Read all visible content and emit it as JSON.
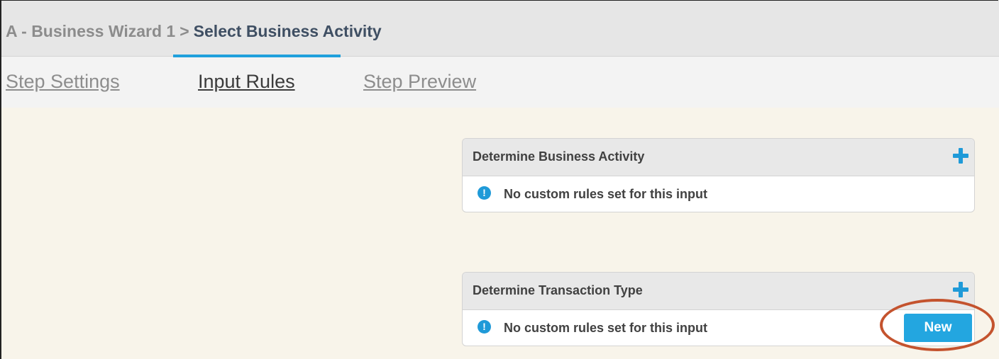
{
  "breadcrumb": {
    "root": "A - Business Wizard 1",
    "separator": ">",
    "current": "Select Business Activity"
  },
  "tabs": [
    {
      "label": "Step Settings",
      "active": false
    },
    {
      "label": "Input Rules",
      "active": true
    },
    {
      "label": "Step Preview",
      "active": false
    }
  ],
  "panels": [
    {
      "title": "Determine Business Activity",
      "message": "No custom rules set for this input",
      "add_icon": "plus-icon"
    },
    {
      "title": "Determine Transaction Type",
      "message": "No custom rules set for this input",
      "add_icon": "plus-icon",
      "new_button": "New"
    }
  ],
  "info_icon_glyph": "!",
  "colors": {
    "accent": "#1f9ad8",
    "button": "#23a6e0",
    "highlight": "#c4532e",
    "content_bg": "#f8f4ea"
  }
}
